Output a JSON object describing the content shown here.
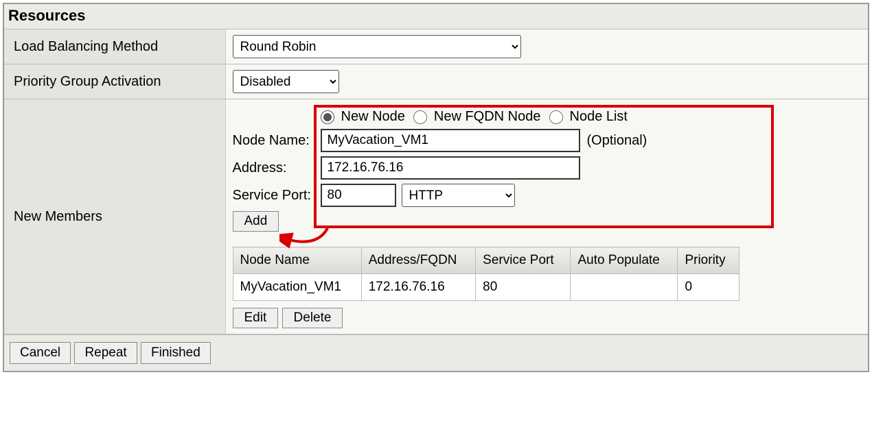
{
  "panel": {
    "title": "Resources"
  },
  "rows": {
    "lb_label": "Load Balancing Method",
    "lb_value": "Round Robin",
    "pga_label": "Priority Group Activation",
    "pga_value": "Disabled",
    "members_label": "New Members"
  },
  "node_form": {
    "radios": {
      "new_node": "New Node",
      "new_fqdn": "New FQDN Node",
      "node_list": "Node List"
    },
    "node_name_label": "Node Name:",
    "node_name_value": "MyVacation_VM1",
    "node_name_optional": "(Optional)",
    "address_label": "Address:",
    "address_value": "172.16.76.16",
    "service_port_label": "Service Port:",
    "service_port_value": "80",
    "service_port_proto": "HTTP",
    "add_button": "Add",
    "edit_button": "Edit",
    "delete_button": "Delete"
  },
  "members_table": {
    "headers": {
      "node_name": "Node Name",
      "address": "Address/FQDN",
      "service_port": "Service Port",
      "auto_populate": "Auto Populate",
      "priority": "Priority"
    },
    "rows": [
      {
        "node_name": "MyVacation_VM1",
        "address": "172.16.76.16",
        "service_port": "80",
        "auto_populate": "",
        "priority": "0"
      }
    ]
  },
  "footer": {
    "cancel": "Cancel",
    "repeat": "Repeat",
    "finished": "Finished"
  },
  "callout": {
    "color": "#d80000"
  }
}
